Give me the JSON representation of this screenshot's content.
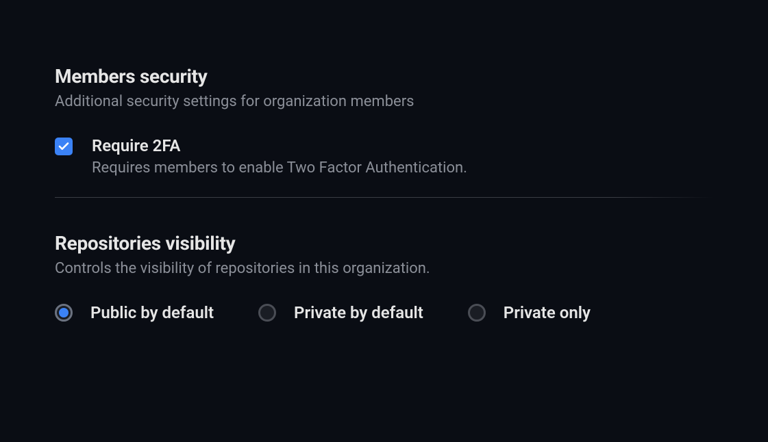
{
  "members_security": {
    "title": "Members security",
    "description": "Additional security settings for organization members",
    "require_2fa": {
      "label": "Require 2FA",
      "hint": "Requires members to enable Two Factor Authentication.",
      "checked": true
    }
  },
  "repositories_visibility": {
    "title": "Repositories visibility",
    "description": "Controls the visibility of repositories in this organization.",
    "options": [
      {
        "label": "Public by default",
        "selected": true
      },
      {
        "label": "Private by default",
        "selected": false
      },
      {
        "label": "Private only",
        "selected": false
      }
    ]
  }
}
